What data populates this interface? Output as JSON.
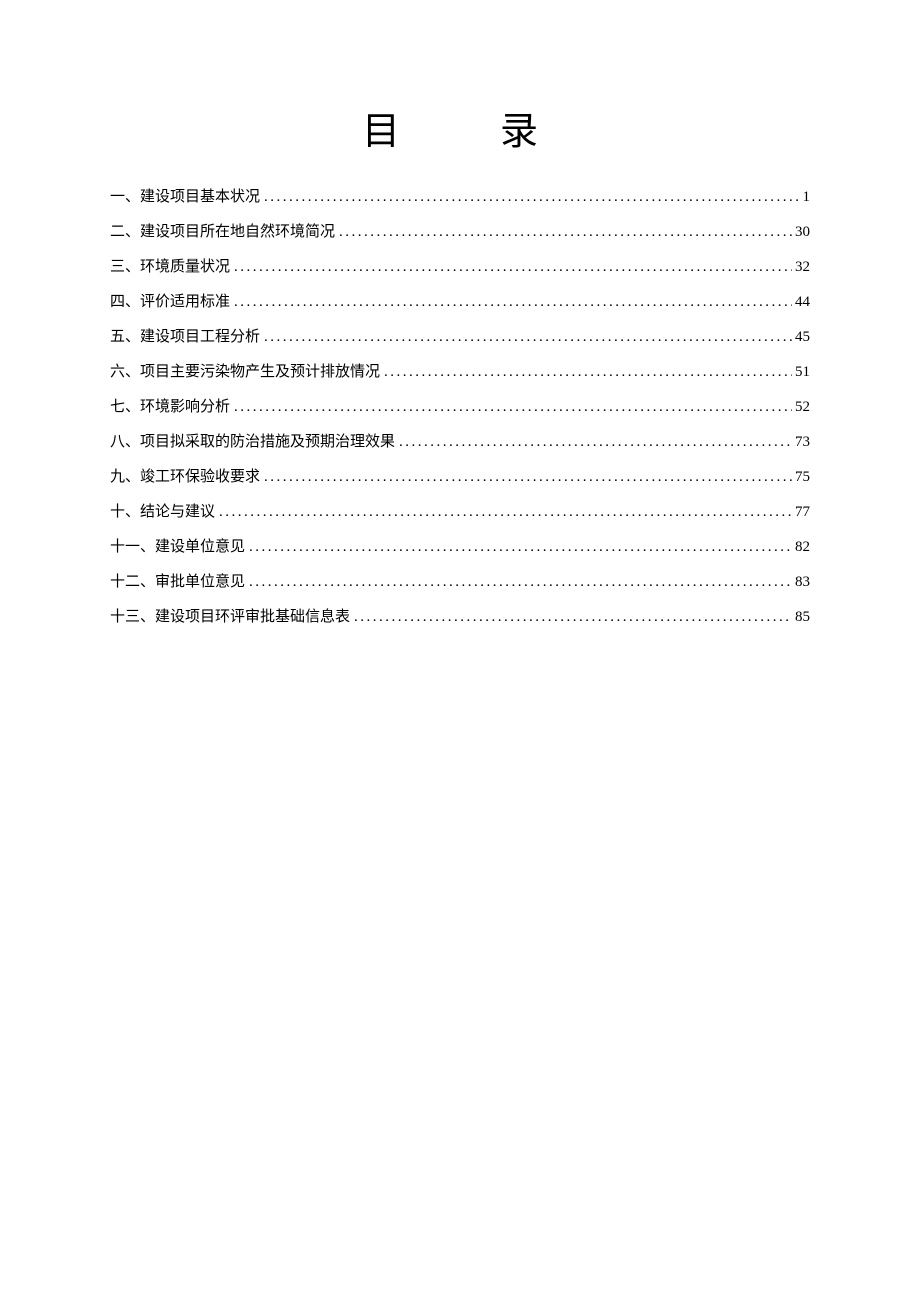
{
  "title": {
    "char1": "目",
    "char2": "录"
  },
  "toc": {
    "entries": [
      {
        "label": "一、建设项目基本状况",
        "page": "1"
      },
      {
        "label": "二、建设项目所在地自然环境简况",
        "page": "30"
      },
      {
        "label": "三、环境质量状况",
        "page": "32"
      },
      {
        "label": "四、评价适用标准",
        "page": "44"
      },
      {
        "label": "五、建设项目工程分析",
        "page": "45"
      },
      {
        "label": "六、项目主要污染物产生及预计排放情况",
        "page": "51"
      },
      {
        "label": "七、环境影响分析",
        "page": "52"
      },
      {
        "label": "八、项目拟采取的防治措施及预期治理效果",
        "page": "73"
      },
      {
        "label": "九、竣工环保验收要求",
        "page": "75"
      },
      {
        "label": "十、结论与建议",
        "page": "77"
      },
      {
        "label": "十一、建设单位意见",
        "page": "82"
      },
      {
        "label": "十二、审批单位意见",
        "page": "83"
      },
      {
        "label": "十三、建设项目环评审批基础信息表",
        "page": "85"
      }
    ]
  }
}
